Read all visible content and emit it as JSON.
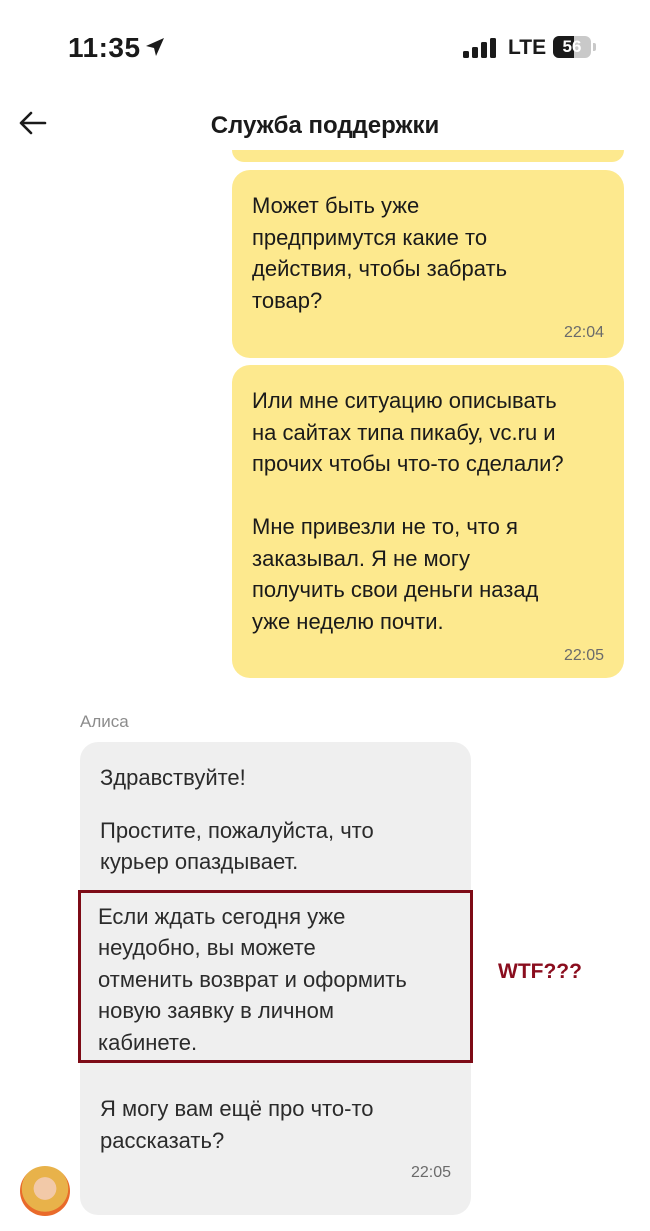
{
  "status_bar": {
    "time": "11:35",
    "network": "LTE",
    "battery": "56",
    "battery_level": 0.56
  },
  "header": {
    "title": "Служба поддержки"
  },
  "messages": [
    {
      "direction": "out",
      "text": "Может быть уже\nпредпримутся какие то\nдействия, чтобы забрать\nтовар?",
      "time": "22:04"
    },
    {
      "direction": "out",
      "text": "Или мне ситуацию описывать\nна сайтах типа пикабу, vc.ru и\nпрочих чтобы что-то сделали?\n\nМне привезли не то, что я\nзаказывал. Я не могу\nполучить свои деньги назад\nуже неделю почти.",
      "time": "22:05"
    },
    {
      "direction": "in",
      "sender": "Алиса",
      "paragraphs": [
        "Здравствуйте!",
        "Простите, пожалуйста, что\nкурьер опаздывает.",
        "Если ждать сегодня уже\nнеудобно, вы можете\nотменить возврат и оформить\nновую заявку в личном\nкабинете.",
        "Я могу вам ещё про что-то\nрассказать?"
      ],
      "time": "22:05"
    }
  ],
  "annotation": {
    "text": "WTF???",
    "color": "#8a0d1e"
  },
  "colors": {
    "outgoing_bubble": "#fde98e",
    "incoming_bubble": "#efefef",
    "highlight_border": "#7d0b16"
  }
}
